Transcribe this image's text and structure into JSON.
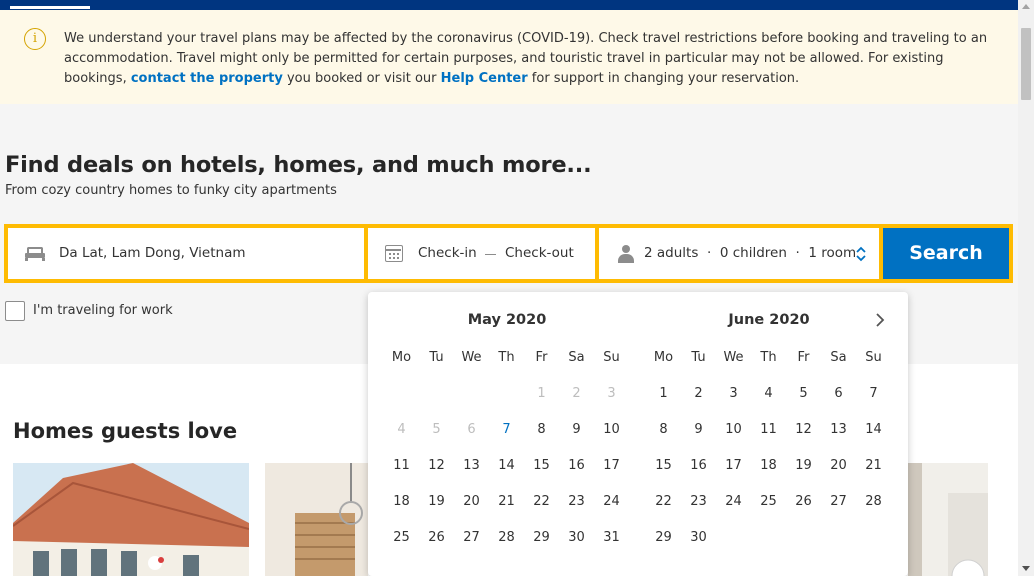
{
  "notice": {
    "text_1": "We understand your travel plans may be affected by the coronavirus (COVID-19). Check travel restrictions before booking and traveling to an accommodation. Travel might only be permitted for certain purposes, and touristic travel in particular may not be allowed. For existing bookings, ",
    "link_property": "contact the property",
    "text_2": " you booked or visit our ",
    "link_help": "Help Center",
    "text_3": " for support in changing your reservation.",
    "icon": "info-icon"
  },
  "hero": {
    "title": "Find deals on hotels, homes, and much more...",
    "subtitle": "From cozy country homes to funky city apartments"
  },
  "search": {
    "destination": "Da Lat, Lam Dong, Vietnam",
    "checkin_label": "Check-in",
    "checkout_label": "Check-out",
    "adults": "2 adults",
    "separator": "·",
    "children": "0 children",
    "rooms": "1 room",
    "button_label": "Search"
  },
  "work_label": "I'm traveling for work",
  "homes_title": "Homes guests love",
  "calendar": {
    "months": [
      {
        "name": "May 2020",
        "weekdays": [
          "Mo",
          "Tu",
          "We",
          "Th",
          "Fr",
          "Sa",
          "Su"
        ],
        "first_weekday_index": 4,
        "days_in_month": 31,
        "disabled_through": 6,
        "today": 7
      },
      {
        "name": "June 2020",
        "weekdays": [
          "Mo",
          "Tu",
          "We",
          "Th",
          "Fr",
          "Sa",
          "Su"
        ],
        "first_weekday_index": 0,
        "days_in_month": 30,
        "disabled_through": 0,
        "today": 0
      }
    ]
  },
  "colors": {
    "brand_blue": "#003580",
    "accent_blue": "#0071c2",
    "search_border": "#febb02",
    "notice_bg": "#fef9e8"
  }
}
